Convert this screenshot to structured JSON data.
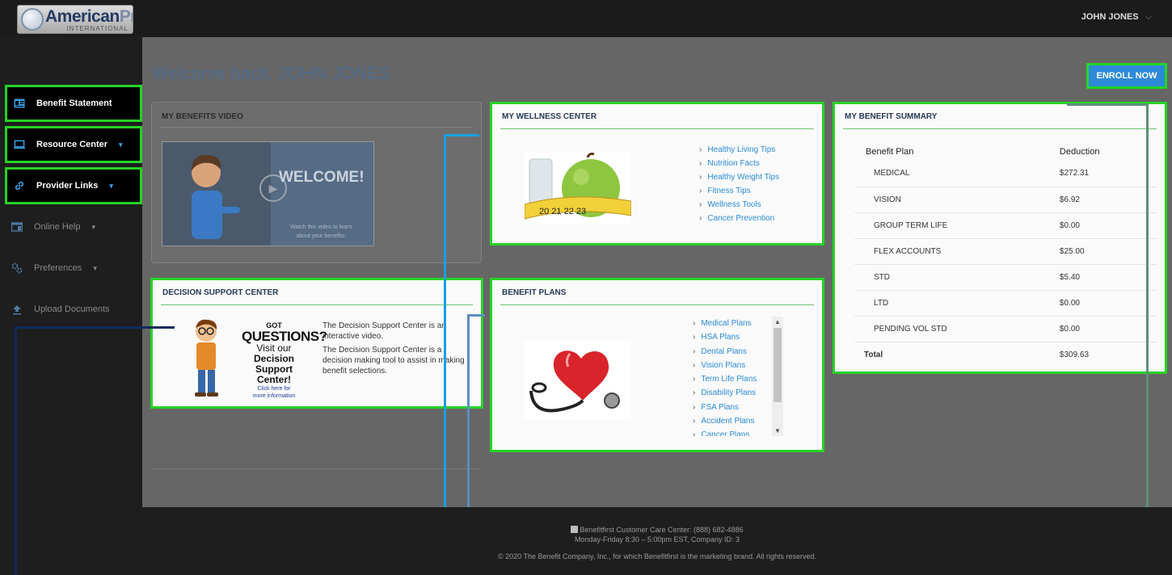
{
  "brand": {
    "name_main": "American",
    "name_accent": "Pro",
    "name_sub": "INTERNATIONAL"
  },
  "user": {
    "name": "JOHN JONES",
    "caret": "⌵"
  },
  "sidebar": {
    "items": [
      {
        "label": "Benefit Statement",
        "icon": "id-card-icon",
        "highlighted": true
      },
      {
        "label": "Resource Center",
        "icon": "monitor-icon",
        "highlighted": true,
        "chevron": "▾"
      },
      {
        "label": "Provider Links",
        "icon": "link-icon",
        "highlighted": true,
        "chevron": "▾"
      },
      {
        "label": "Online Help",
        "icon": "help-window-icon",
        "highlighted": false,
        "chevron": "▾"
      },
      {
        "label": "Preferences",
        "icon": "gears-icon",
        "highlighted": false,
        "chevron": "▾"
      },
      {
        "label": "Upload Documents",
        "icon": "upload-icon",
        "highlighted": false
      }
    ]
  },
  "welcome": "Welcome back, JOHN JONES",
  "enroll_label": "ENROLL NOW",
  "video_panel": {
    "title": "MY BENEFITS VIDEO",
    "thumb_title": "WELCOME!",
    "thumb_sub1": "Watch this video to learn",
    "thumb_sub2": "about your benefits."
  },
  "wellness": {
    "title": "MY WELLNESS CENTER",
    "links": [
      "Healthy Living Tips",
      "Nutrition Facts",
      "Healthy Weight Tips",
      "Fitness Tips",
      "Wellness Tools",
      "Cancer Prevention"
    ]
  },
  "summary": {
    "title": "MY BENEFIT SUMMARY",
    "headers": [
      "Benefit Plan",
      "Deduction"
    ],
    "rows": [
      {
        "plan": "MEDICAL",
        "amount": "$272.31"
      },
      {
        "plan": "VISION",
        "amount": "$6.92"
      },
      {
        "plan": "GROUP TERM LIFE",
        "amount": "$0.00"
      },
      {
        "plan": "FLEX ACCOUNTS",
        "amount": "$25.00"
      },
      {
        "plan": "STD",
        "amount": "$5.40"
      },
      {
        "plan": "LTD",
        "amount": "$0.00"
      },
      {
        "plan": "PENDING VOL STD",
        "amount": "$0.00"
      }
    ],
    "total_label": "Total",
    "total_amount": "$309.63"
  },
  "decision": {
    "title": "DECISION SUPPORT CENTER",
    "p1": "The Decision Support Center is an interactive video.",
    "p2": "The Decision Support Center is a decision making tool to assist in making benefit selections.",
    "art_got": "GOT",
    "art_questions": "QUESTIONS?",
    "art_visit": "Visit our",
    "art_dsc1": "Decision Support",
    "art_dsc2": "Center!",
    "art_click1": "Click here for",
    "art_click2": "more information"
  },
  "plans": {
    "title": "BENEFIT PLANS",
    "links": [
      "Medical Plans",
      "HSA Plans",
      "Dental Plans",
      "Vision Plans",
      "Term Life Plans",
      "Disability Plans",
      "FSA Plans",
      "Accident Plans",
      "Cancer Plans"
    ],
    "scroll_up": "▲",
    "scroll_down": "▼"
  },
  "footer": {
    "line1": "Benefitfirst Customer Care Center: (888) 682-4886",
    "line2": "Monday-Friday 8:30 – 5:00pm EST, Company ID: 3",
    "line3": "© 2020 The Benefit Company, Inc., for which Benefitfirst is the marketing brand. All rights reserved."
  },
  "colors": {
    "highlight": "#26d326",
    "accent": "#2c8ad9",
    "link": "#2a8ad6"
  }
}
